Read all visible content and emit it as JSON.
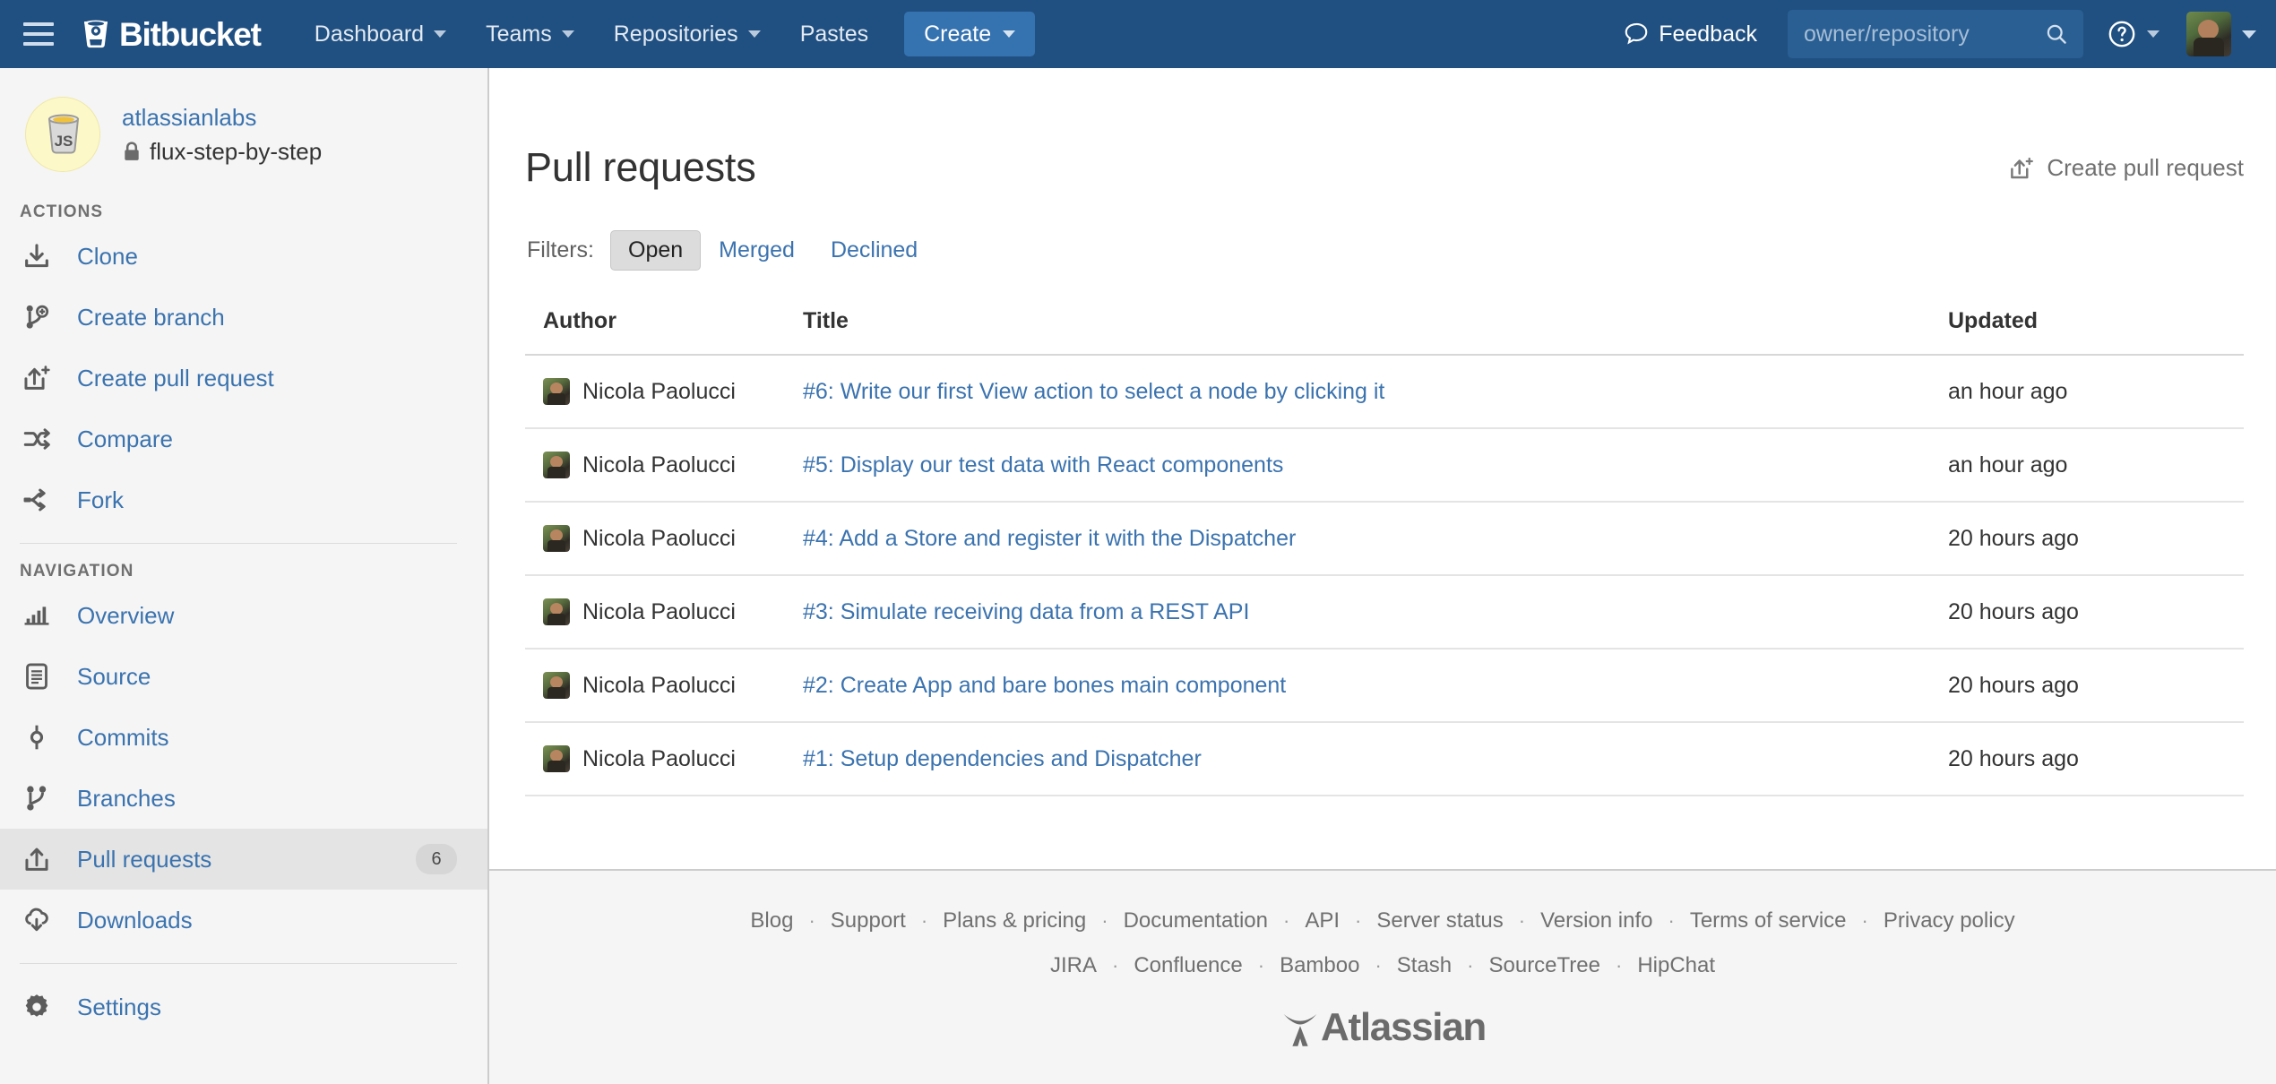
{
  "header": {
    "menu_icon": "hamburger-icon",
    "brand": "Bitbucket",
    "nav": [
      {
        "label": "Dashboard",
        "has_caret": true
      },
      {
        "label": "Teams",
        "has_caret": true
      },
      {
        "label": "Repositories",
        "has_caret": true
      },
      {
        "label": "Pastes",
        "has_caret": false
      }
    ],
    "create_label": "Create",
    "feedback_label": "Feedback",
    "search_placeholder": "owner/repository",
    "search_value": "",
    "search_icon": "search-icon",
    "help_icon": "question-circle-icon",
    "avatar_icon": "user-avatar"
  },
  "sidebar": {
    "repo": {
      "owner": "atlassianlabs",
      "name": "flux-step-by-step",
      "privacy_icon": "lock-icon",
      "avatar_icon": "js-coffee-cup-icon"
    },
    "actions_title": "ACTIONS",
    "actions": [
      {
        "label": "Clone",
        "icon": "download-icon"
      },
      {
        "label": "Create branch",
        "icon": "branch-plus-icon"
      },
      {
        "label": "Create pull request",
        "icon": "pull-request-plus-icon"
      },
      {
        "label": "Compare",
        "icon": "compare-arrows-icon"
      },
      {
        "label": "Fork",
        "icon": "fork-icon"
      }
    ],
    "navigation_title": "NAVIGATION",
    "navigation": [
      {
        "label": "Overview",
        "icon": "bar-chart-icon",
        "badge": "",
        "active": false
      },
      {
        "label": "Source",
        "icon": "document-icon",
        "badge": "",
        "active": false
      },
      {
        "label": "Commits",
        "icon": "commit-node-icon",
        "badge": "",
        "active": false
      },
      {
        "label": "Branches",
        "icon": "branch-icon",
        "badge": "",
        "active": false
      },
      {
        "label": "Pull requests",
        "icon": "pull-request-icon",
        "badge": "6",
        "active": true
      },
      {
        "label": "Downloads",
        "icon": "cloud-download-icon",
        "badge": "",
        "active": false
      }
    ],
    "settings": {
      "label": "Settings",
      "icon": "gear-icon"
    }
  },
  "main": {
    "title": "Pull requests",
    "create_pr_label": "Create pull request",
    "create_pr_icon": "pull-request-plus-icon",
    "filters_label": "Filters:",
    "filters": [
      {
        "label": "Open",
        "active": true
      },
      {
        "label": "Merged",
        "active": false
      },
      {
        "label": "Declined",
        "active": false
      }
    ],
    "table": {
      "columns": [
        "Author",
        "Title",
        "Updated"
      ],
      "rows": [
        {
          "author": "Nicola Paolucci",
          "title": "#6: Write our first View action to select a node by clicking it",
          "updated": "an hour ago"
        },
        {
          "author": "Nicola Paolucci",
          "title": "#5: Display our test data with React components",
          "updated": "an hour ago"
        },
        {
          "author": "Nicola Paolucci",
          "title": "#4: Add a Store and register it with the Dispatcher",
          "updated": "20 hours ago"
        },
        {
          "author": "Nicola Paolucci",
          "title": "#3: Simulate receiving data from a REST API",
          "updated": "20 hours ago"
        },
        {
          "author": "Nicola Paolucci",
          "title": "#2: Create App and bare bones main component",
          "updated": "20 hours ago"
        },
        {
          "author": "Nicola Paolucci",
          "title": "#1: Setup dependencies and Dispatcher",
          "updated": "20 hours ago"
        }
      ]
    }
  },
  "footer": {
    "primary_links": [
      "Blog",
      "Support",
      "Plans & pricing",
      "Documentation",
      "API",
      "Server status",
      "Version info",
      "Terms of service",
      "Privacy policy"
    ],
    "secondary_links": [
      "JIRA",
      "Confluence",
      "Bamboo",
      "Stash",
      "SourceTree",
      "HipChat"
    ],
    "separator": "·",
    "logo_text": "Atlassian",
    "logo_icon": "atlassian-logo-icon"
  },
  "colors": {
    "header_bg": "#205081",
    "create_button": "#3572b0",
    "link": "#3b73af",
    "sidebar_bg": "#f5f5f5",
    "active_row": "#e4e4e4",
    "badge_bg": "#d6d6d6"
  }
}
